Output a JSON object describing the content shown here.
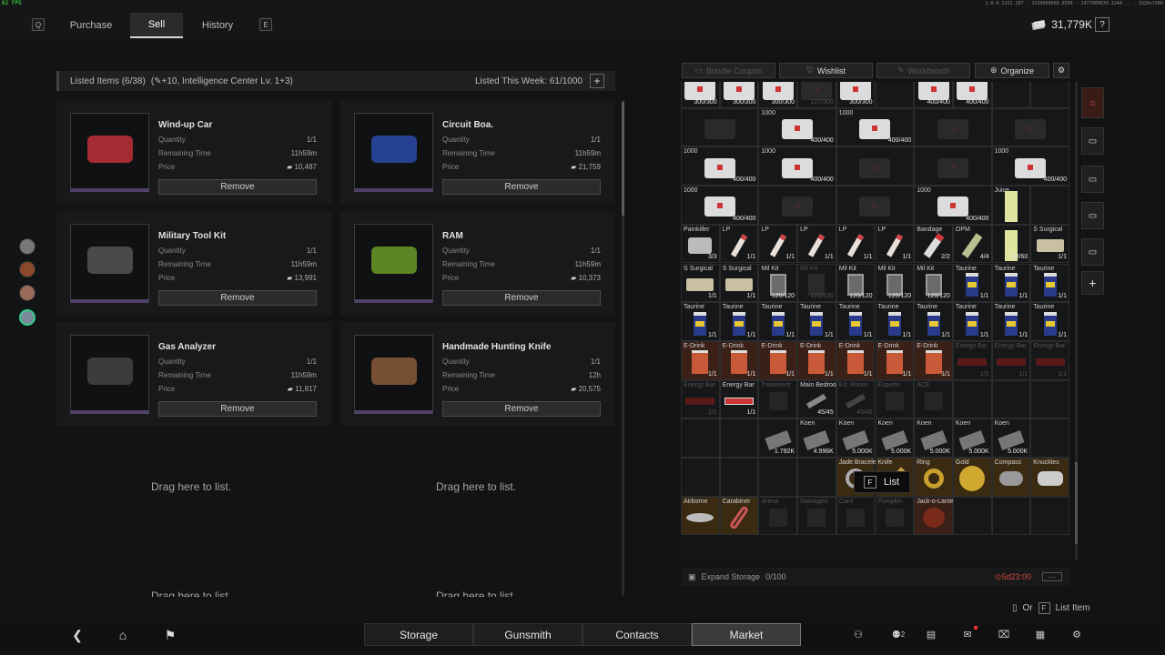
{
  "topbar": {
    "fps": "62 FPS",
    "version": "1.0.0.1151.107 · 1230000000.8500 · 1477089639.1244... · 1920x1080",
    "key_q": "Q",
    "key_e": "E",
    "tabs": [
      {
        "label": "Purchase",
        "active": false
      },
      {
        "label": "Sell",
        "active": true
      },
      {
        "label": "History",
        "active": false
      }
    ],
    "money": "31,779K",
    "help": "?"
  },
  "listed": {
    "header": "Listed Items (6/38)",
    "bonus": "(✎+10, Intelligence Center Lv. 1+3)",
    "this_week": "Listed This Week: 61/1000",
    "plus": "+",
    "labels": {
      "quantity": "Quantity",
      "remaining": "Remaining Time",
      "price": "Price",
      "remove": "Remove"
    },
    "cards": [
      {
        "name": "Wind-up Car",
        "quantity": "1/1",
        "remaining": "11h59m",
        "price": "10,487",
        "color": "#c0303a"
      },
      {
        "name": "Circuit Boa.",
        "quantity": "1/1",
        "remaining": "11h59m",
        "price": "21,759",
        "color": "#2a4aa8"
      },
      {
        "name": "Military Tool Kit",
        "quantity": "1/1",
        "remaining": "11h59m",
        "price": "13,991",
        "color": "#555"
      },
      {
        "name": "RAM",
        "quantity": "1/1",
        "remaining": "11h59m",
        "price": "10,373",
        "color": "#6a9a2a"
      },
      {
        "name": "Gas Analyzer",
        "quantity": "1/1",
        "remaining": "11h59m",
        "price": "11,817",
        "color": "#444"
      },
      {
        "name": "Handmade Hunting Knife",
        "quantity": "1/1",
        "remaining": "12h",
        "price": "20,575",
        "color": "#8a5a3a"
      }
    ],
    "drag_text": "Drag here to list."
  },
  "inventory": {
    "buttons": {
      "bundle": "Bundle Coupon",
      "wishlist": "Wishlist",
      "workbench": "Workbench",
      "organize": "Organize"
    },
    "tooltip": {
      "key": "F",
      "label": "List"
    },
    "expand_label": "Expand Storage",
    "expand_count": "0/100",
    "timer": "5d23:00",
    "more": "···"
  },
  "hint": {
    "or": "Or",
    "key": "F",
    "label": "List Item"
  },
  "bottom": {
    "tabs": [
      {
        "label": "Storage",
        "active": false
      },
      {
        "label": "Gunsmith",
        "active": false
      },
      {
        "label": "Contacts",
        "active": false
      },
      {
        "label": "Market",
        "active": true
      }
    ],
    "friends_count": "2"
  },
  "grid_rows": [
    [
      {
        "n": "",
        "c": "300/300",
        "t": "bag"
      },
      {
        "n": "",
        "c": "300/300",
        "t": "bag"
      },
      {
        "n": "",
        "c": "300/300",
        "t": "bag"
      },
      {
        "n": "",
        "c": "127/300",
        "t": "bagdim"
      },
      {
        "n": "",
        "c": "300/300",
        "t": "bag"
      },
      {
        "n": "",
        "c": "",
        "t": "empty"
      },
      {
        "n": "",
        "c": "400/400",
        "t": "bag"
      },
      {
        "n": "",
        "c": "400/400",
        "t": "bag"
      },
      {
        "n": "",
        "c": "",
        "t": "empty"
      },
      {
        "n": "",
        "c": "",
        "t": "empty"
      }
    ],
    [
      {
        "n": "",
        "c": "",
        "t": "bagdim"
      },
      {
        "n": "1000",
        "c": "400/400",
        "t": "bag"
      },
      {
        "n": "1000",
        "c": "400/400",
        "t": "bag"
      },
      {
        "n": "",
        "c": "",
        "t": "bagdim"
      },
      {
        "n": "",
        "c": "",
        "t": "bagdim"
      }
    ],
    [
      {
        "n": "1000",
        "c": "400/400",
        "t": "bag"
      },
      {
        "n": "1000",
        "c": "400/400",
        "t": "bag"
      },
      {
        "n": "",
        "c": "",
        "t": "bagdim"
      },
      {
        "n": "",
        "c": "",
        "t": "bagdim"
      },
      {
        "n": "1000",
        "c": "400/400",
        "t": "bag"
      }
    ],
    [
      {
        "n": "1000",
        "c": "400/400",
        "t": "bag"
      },
      {
        "n": "",
        "c": "",
        "t": "bagdim"
      },
      {
        "n": "",
        "c": "",
        "t": "bagdim"
      },
      {
        "n": "1000",
        "c": "400/400",
        "t": "bag"
      },
      {
        "n": "Juice",
        "c": "",
        "t": "juice"
      },
      {
        "n": "",
        "c": "",
        "t": "empty"
      }
    ],
    [
      {
        "n": "Painkiller",
        "c": "3/3",
        "t": "pill"
      },
      {
        "n": "LP",
        "c": "1/1",
        "t": "lp"
      },
      {
        "n": "LP",
        "c": "1/1",
        "t": "lp"
      },
      {
        "n": "LP",
        "c": "1/1",
        "t": "lp"
      },
      {
        "n": "LP",
        "c": "1/1",
        "t": "lp"
      },
      {
        "n": "LP",
        "c": "1/1",
        "t": "lp"
      },
      {
        "n": "Bandage",
        "c": "2/2",
        "t": "band"
      },
      {
        "n": "OPM",
        "c": "4/4",
        "t": "opm"
      },
      {
        "n": "",
        "c": "60/60",
        "t": "juice2"
      },
      {
        "n": "S Surgical",
        "c": "1/1",
        "t": "surg"
      }
    ],
    [
      {
        "n": "S Surgical",
        "c": "1/1",
        "t": "surg"
      },
      {
        "n": "S Surgical",
        "c": "1/1",
        "t": "surg"
      },
      {
        "n": "Mil Kit",
        "c": "120/120",
        "t": "mil"
      },
      {
        "n": "Mil Kit",
        "c": "120/120",
        "t": "mildim"
      },
      {
        "n": "Mil Kit",
        "c": "120/120",
        "t": "mil"
      },
      {
        "n": "Mil Kit",
        "c": "120/120",
        "t": "mil"
      },
      {
        "n": "Mil Kit",
        "c": "120/120",
        "t": "mil"
      },
      {
        "n": "Taurine",
        "c": "1/1",
        "t": "can"
      },
      {
        "n": "Taurine",
        "c": "1/1",
        "t": "can"
      },
      {
        "n": "Taurine",
        "c": "1/1",
        "t": "can"
      }
    ],
    [
      {
        "n": "Taurine",
        "c": "1/1",
        "t": "can"
      },
      {
        "n": "Taurine",
        "c": "1/1",
        "t": "can"
      },
      {
        "n": "Taurine",
        "c": "1/1",
        "t": "can"
      },
      {
        "n": "Taurine",
        "c": "1/1",
        "t": "can"
      },
      {
        "n": "Taurine",
        "c": "1/1",
        "t": "can"
      },
      {
        "n": "Taurine",
        "c": "1/1",
        "t": "can"
      },
      {
        "n": "Taurine",
        "c": "1/1",
        "t": "can"
      },
      {
        "n": "Taurine",
        "c": "1/1",
        "t": "can"
      },
      {
        "n": "Taurine",
        "c": "1/1",
        "t": "can"
      },
      {
        "n": "Taurine",
        "c": "1/1",
        "t": "can"
      }
    ],
    [
      {
        "n": "E-Drink",
        "c": "1/1",
        "t": "edr"
      },
      {
        "n": "E-Drink",
        "c": "1/1",
        "t": "edr"
      },
      {
        "n": "E-Drink",
        "c": "1/1",
        "t": "edr"
      },
      {
        "n": "E-Drink",
        "c": "1/1",
        "t": "edr"
      },
      {
        "n": "E-Drink",
        "c": "1/1",
        "t": "edr"
      },
      {
        "n": "E-Drink",
        "c": "1/1",
        "t": "edr"
      },
      {
        "n": "E-Drink",
        "c": "1/1",
        "t": "edr"
      },
      {
        "n": "Energy Bar",
        "c": "1/1",
        "t": "bardim"
      },
      {
        "n": "Energy Bar",
        "c": "1/1",
        "t": "bardim"
      },
      {
        "n": "Energy Bar",
        "c": "1/1",
        "t": "bardim"
      }
    ],
    [
      {
        "n": "Energy Bar",
        "c": "1/1",
        "t": "bardim"
      },
      {
        "n": "Energy Bar",
        "c": "1/1",
        "t": "bar"
      },
      {
        "n": "Treatment",
        "c": "",
        "t": "dim"
      },
      {
        "n": "Main Bedroom",
        "c": "45/45",
        "t": "key"
      },
      {
        "n": "Ed. Room",
        "c": "45/45",
        "t": "keydim"
      },
      {
        "n": "Experts",
        "c": "",
        "t": "dim"
      },
      {
        "n": "ACE",
        "c": "",
        "t": "dim"
      },
      {
        "n": "",
        "c": "",
        "t": "empty"
      },
      {
        "n": "",
        "c": "",
        "t": "empty"
      },
      {
        "n": "",
        "c": "",
        "t": "empty"
      }
    ],
    [
      {
        "n": "",
        "c": "",
        "t": "empty"
      },
      {
        "n": "",
        "c": "",
        "t": "empty"
      },
      {
        "n": "",
        "c": "1.792K",
        "t": "cash"
      },
      {
        "n": "Koen",
        "c": "4.996K",
        "t": "cash"
      },
      {
        "n": "Koen",
        "c": "5.000K",
        "t": "cash"
      },
      {
        "n": "Koen",
        "c": "5.000K",
        "t": "cash"
      },
      {
        "n": "Koen",
        "c": "5.000K",
        "t": "cash"
      },
      {
        "n": "Koen",
        "c": "5.000K",
        "t": "cash"
      },
      {
        "n": "Koen",
        "c": "5.000K",
        "t": "cash"
      },
      {
        "n": "",
        "c": "",
        "t": "empty"
      }
    ],
    [
      {
        "n": "",
        "c": "",
        "t": "empty"
      },
      {
        "n": "",
        "c": "",
        "t": "empty"
      },
      {
        "n": "",
        "c": "",
        "t": "empty"
      },
      {
        "n": "",
        "c": "",
        "t": "empty"
      },
      {
        "n": "Jade Bracelet",
        "c": "",
        "t": "jade"
      },
      {
        "n": "Knife",
        "c": "",
        "t": "knife"
      },
      {
        "n": "Ring",
        "c": "",
        "t": "ring"
      },
      {
        "n": "Gold",
        "c": "",
        "t": "goldc"
      },
      {
        "n": "Compass",
        "c": "",
        "t": "comp"
      },
      {
        "n": "Knuckles",
        "c": "",
        "t": "knuck"
      }
    ],
    [
      {
        "n": "Airborne",
        "c": "",
        "t": "air"
      },
      {
        "n": "Carabiner",
        "c": "",
        "t": "cara"
      },
      {
        "n": "Arena",
        "c": "",
        "t": "dim"
      },
      {
        "n": "Damaged",
        "c": "",
        "t": "dim"
      },
      {
        "n": "Card",
        "c": "",
        "t": "dim"
      },
      {
        "n": "Pumpkin",
        "c": "",
        "t": "dim"
      },
      {
        "n": "Jack-o-Lantern",
        "c": "",
        "t": "lantern"
      },
      {
        "n": "",
        "c": "",
        "t": "empty"
      },
      {
        "n": "",
        "c": "",
        "t": "empty"
      },
      {
        "n": "",
        "c": "",
        "t": "empty"
      }
    ]
  ]
}
